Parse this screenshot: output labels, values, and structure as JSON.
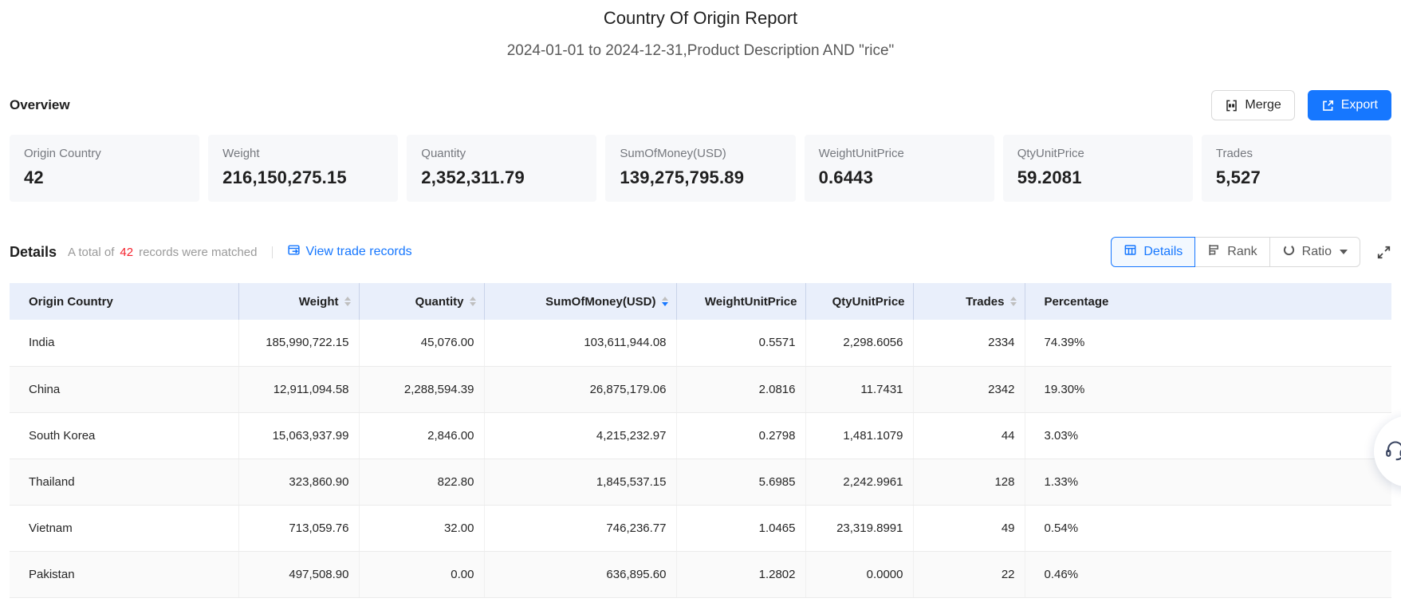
{
  "report": {
    "title": "Country Of Origin Report",
    "subtitle": "2024-01-01 to 2024-12-31,Product Description AND \"rice\""
  },
  "overview": {
    "heading": "Overview",
    "merge_label": "Merge",
    "export_label": "Export",
    "cards": [
      {
        "label": "Origin Country",
        "value": "42"
      },
      {
        "label": "Weight",
        "value": "216,150,275.15"
      },
      {
        "label": "Quantity",
        "value": "2,352,311.79"
      },
      {
        "label": "SumOfMoney(USD)",
        "value": "139,275,795.89"
      },
      {
        "label": "WeightUnitPrice",
        "value": "0.6443"
      },
      {
        "label": "QtyUnitPrice",
        "value": "59.2081"
      },
      {
        "label": "Trades",
        "value": "5,527"
      }
    ]
  },
  "details": {
    "heading": "Details",
    "match_prefix": "A total of",
    "match_count": "42",
    "match_suffix": "records were matched",
    "view_link": "View trade records",
    "tabs": [
      {
        "label": "Details",
        "active": true
      },
      {
        "label": "Rank",
        "active": false
      },
      {
        "label": "Ratio",
        "active": false,
        "dropdown": true
      }
    ]
  },
  "table": {
    "columns": [
      {
        "label": "Origin Country",
        "align": "left",
        "sortable": false
      },
      {
        "label": "Weight",
        "align": "right",
        "sortable": true
      },
      {
        "label": "Quantity",
        "align": "right",
        "sortable": true
      },
      {
        "label": "SumOfMoney(USD)",
        "align": "right",
        "sortable": true,
        "sort": "desc"
      },
      {
        "label": "WeightUnitPrice",
        "align": "right",
        "sortable": false
      },
      {
        "label": "QtyUnitPrice",
        "align": "right",
        "sortable": false
      },
      {
        "label": "Trades",
        "align": "right",
        "sortable": true
      },
      {
        "label": "Percentage",
        "align": "left",
        "sortable": false
      }
    ],
    "rows": [
      [
        "India",
        "185,990,722.15",
        "45,076.00",
        "103,611,944.08",
        "0.5571",
        "2,298.6056",
        "2334",
        "74.39%"
      ],
      [
        "China",
        "12,911,094.58",
        "2,288,594.39",
        "26,875,179.06",
        "2.0816",
        "11.7431",
        "2342",
        "19.30%"
      ],
      [
        "South Korea",
        "15,063,937.99",
        "2,846.00",
        "4,215,232.97",
        "0.2798",
        "1,481.1079",
        "44",
        "3.03%"
      ],
      [
        "Thailand",
        "323,860.90",
        "822.80",
        "1,845,537.15",
        "5.6985",
        "2,242.9961",
        "128",
        "1.33%"
      ],
      [
        "Vietnam",
        "713,059.76",
        "32.00",
        "746,236.77",
        "1.0465",
        "23,319.8991",
        "49",
        "0.54%"
      ],
      [
        "Pakistan",
        "497,508.90",
        "0.00",
        "636,895.60",
        "1.2802",
        "0.0000",
        "22",
        "0.46%"
      ]
    ]
  },
  "colors": {
    "accent_blue": "#1677ff",
    "count_red": "#f5222d",
    "table_header_bg": "#e9effb",
    "card_bg": "#f7f8fa"
  }
}
